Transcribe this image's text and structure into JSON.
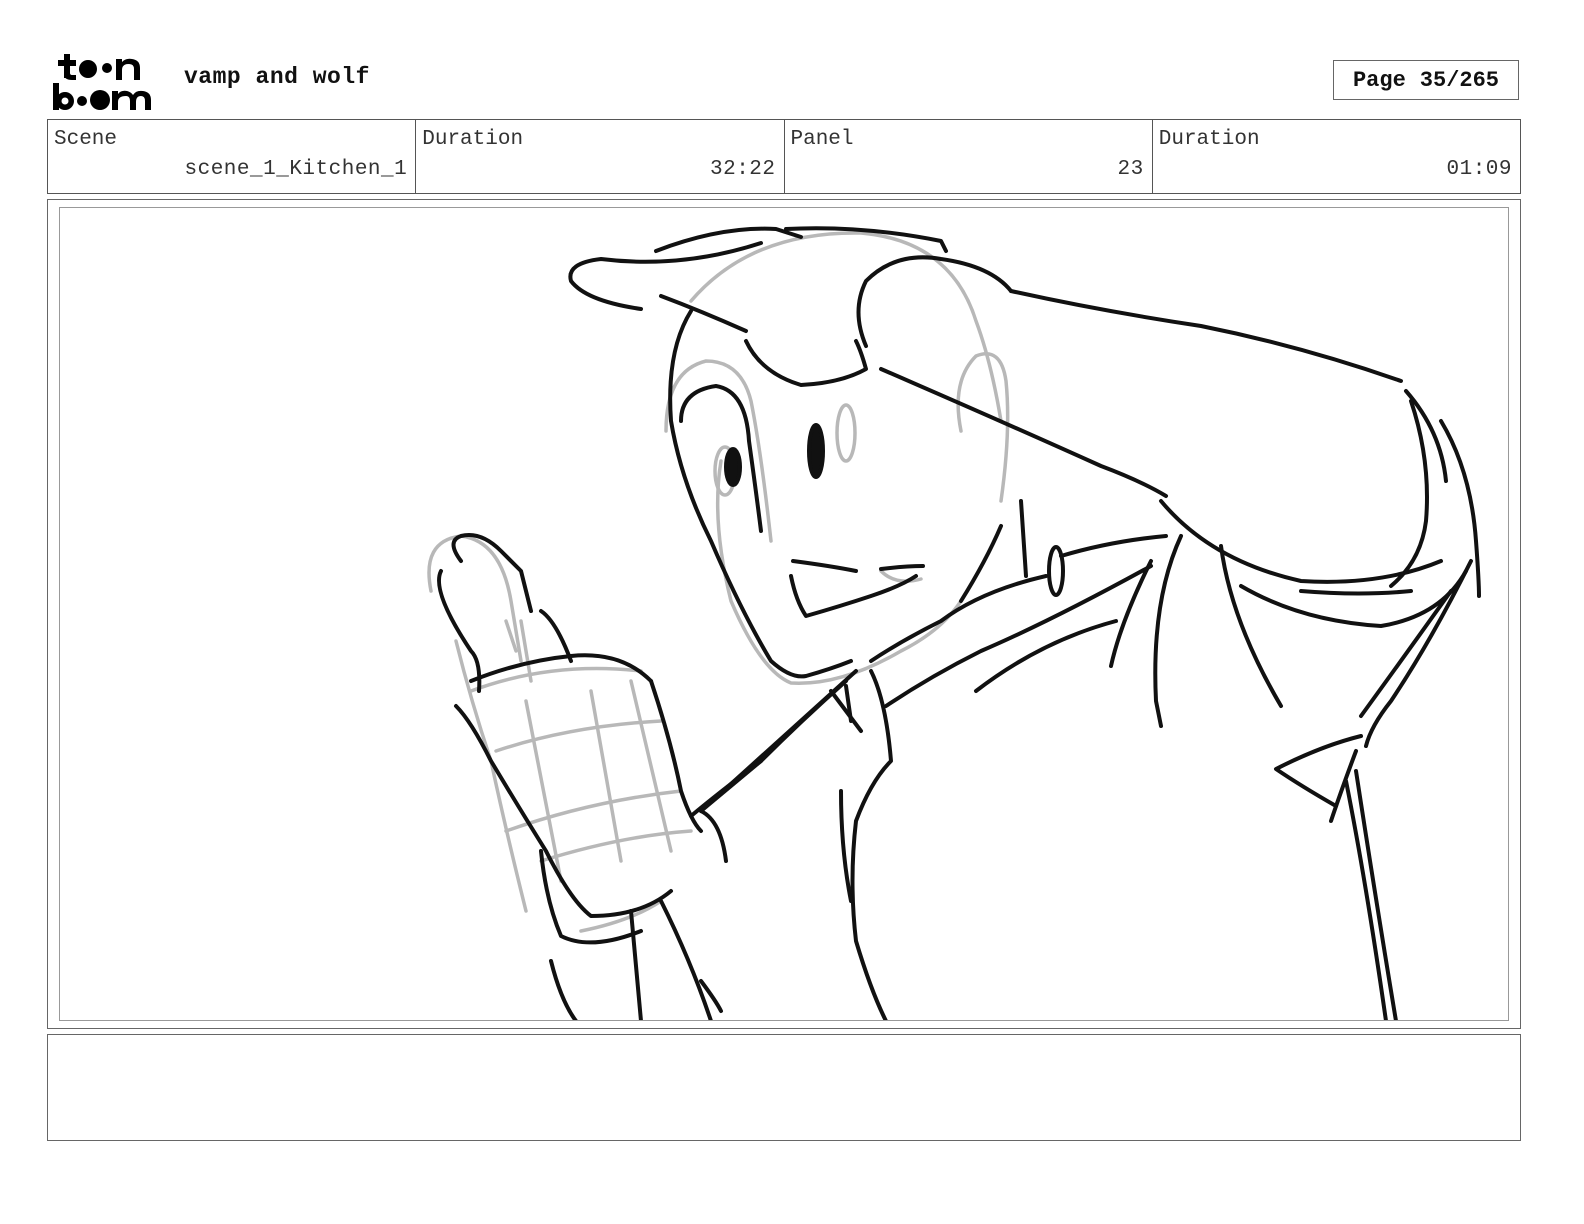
{
  "header": {
    "logo_text": "toon boom",
    "project_title": "vamp and wolf",
    "page_label": "Page",
    "page_number": "35/265"
  },
  "info": {
    "scene_label": "Scene",
    "scene_value": "scene_1_Kitchen_1",
    "scene_duration_label": "Duration",
    "scene_duration_value": "32:22",
    "panel_label": "Panel",
    "panel_value": "23",
    "panel_duration_label": "Duration",
    "panel_duration_value": "01:09"
  },
  "panel": {
    "sketch_colors": {
      "final": "#111111",
      "rough": "#b8b8b8"
    }
  },
  "notes": {
    "text": ""
  }
}
